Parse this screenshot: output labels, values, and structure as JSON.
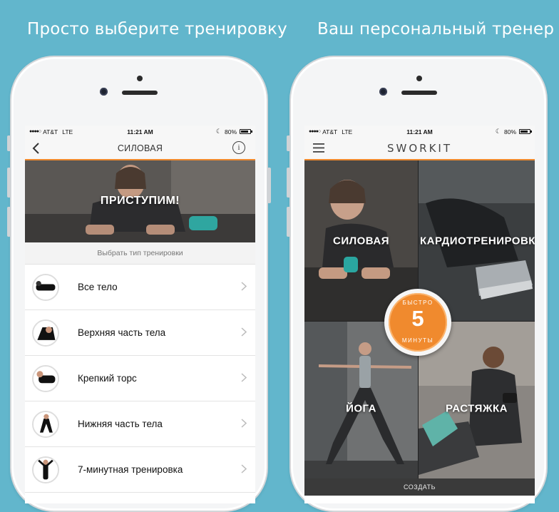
{
  "captions": {
    "left": "Просто выберите тренировку",
    "right": "Ваш персональный тренер"
  },
  "status_bar": {
    "carrier": "AT&T",
    "network": "LTE",
    "time": "11:21 AM",
    "battery": "80%"
  },
  "left_screen": {
    "nav_title": "СИЛОВАЯ",
    "info_symbol": "i",
    "hero_label": "ПРИСТУПИМ!",
    "section_header": "Выбрать тип тренировки",
    "items": [
      {
        "label": "Все тело",
        "icon": "full-body-thumb"
      },
      {
        "label": "Верхняя часть тела",
        "icon": "upper-body-thumb"
      },
      {
        "label": "Крепкий торс",
        "icon": "core-thumb"
      },
      {
        "label": "Нижняя часть тела",
        "icon": "lower-body-thumb"
      },
      {
        "label": "7-минутная тренировка",
        "icon": "seven-minute-thumb"
      }
    ]
  },
  "right_screen": {
    "brand": "SWORKIT",
    "tiles": {
      "strength": "СИЛОВАЯ",
      "cardio": "КАРДИОТРЕНИРОВКА",
      "yoga": "ЙОГА",
      "stretch": "РАСТЯЖКА"
    },
    "quick": {
      "top": "БЫСТРО",
      "number": "5",
      "bottom": "МИНУТЫ"
    },
    "create_label": "СОЗДАТЬ"
  },
  "colors": {
    "background": "#62b6cc",
    "accent": "#f08a2e"
  }
}
